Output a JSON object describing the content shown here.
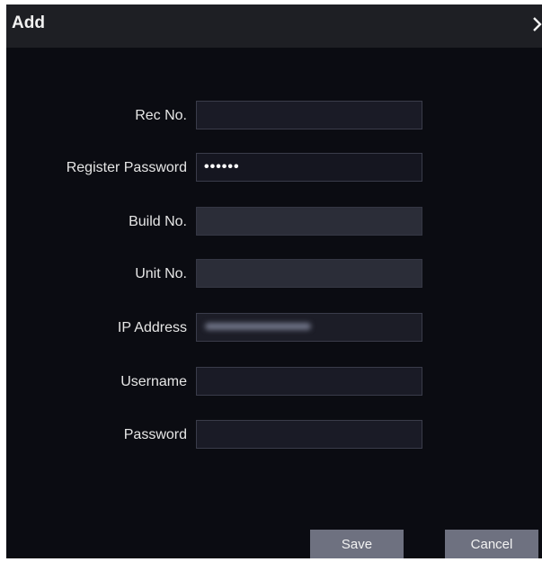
{
  "dialog": {
    "title": "Add",
    "close_icon": "chevron-right-icon"
  },
  "form": {
    "rec_no": {
      "label": "Rec No.",
      "value": ""
    },
    "register_password": {
      "label": "Register Password",
      "value": "••••••"
    },
    "build_no": {
      "label": "Build No.",
      "value": ""
    },
    "unit_no": {
      "label": "Unit No.",
      "value": ""
    },
    "ip_address": {
      "label": "IP Address",
      "value": ""
    },
    "username": {
      "label": "Username",
      "value": ""
    },
    "password": {
      "label": "Password",
      "value": ""
    }
  },
  "buttons": {
    "save": "Save",
    "cancel": "Cancel"
  },
  "colors": {
    "dialog_background": "#0b0c12",
    "titlebar_background": "#1e1f24",
    "button_background": "#6e7180"
  }
}
